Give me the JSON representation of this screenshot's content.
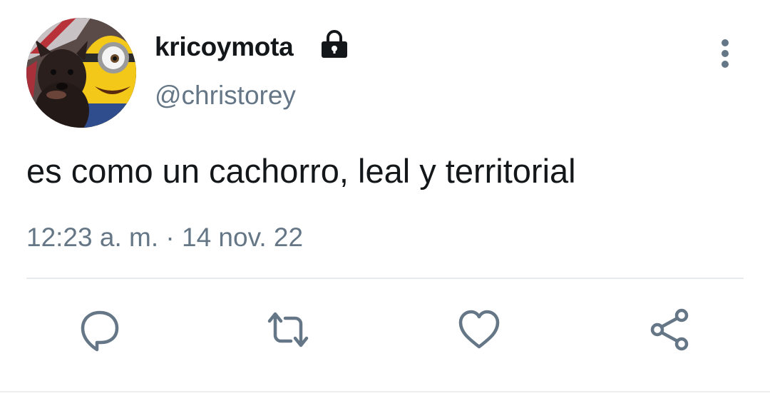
{
  "tweet": {
    "user_name": "kricoymota",
    "user_handle": "@christorey",
    "text": "es como un cachorro, leal y territorial",
    "timestamp": "12:23 a. m. · 14 nov. 22",
    "protected": true
  },
  "icons": {
    "lock": "lock-icon",
    "more": "more-vertical-icon",
    "reply": "reply-icon",
    "retweet": "retweet-icon",
    "like": "heart-icon",
    "share": "share-icon"
  },
  "colors": {
    "text": "#14171a",
    "secondary": "#657786",
    "divider": "#e6ecf0"
  }
}
